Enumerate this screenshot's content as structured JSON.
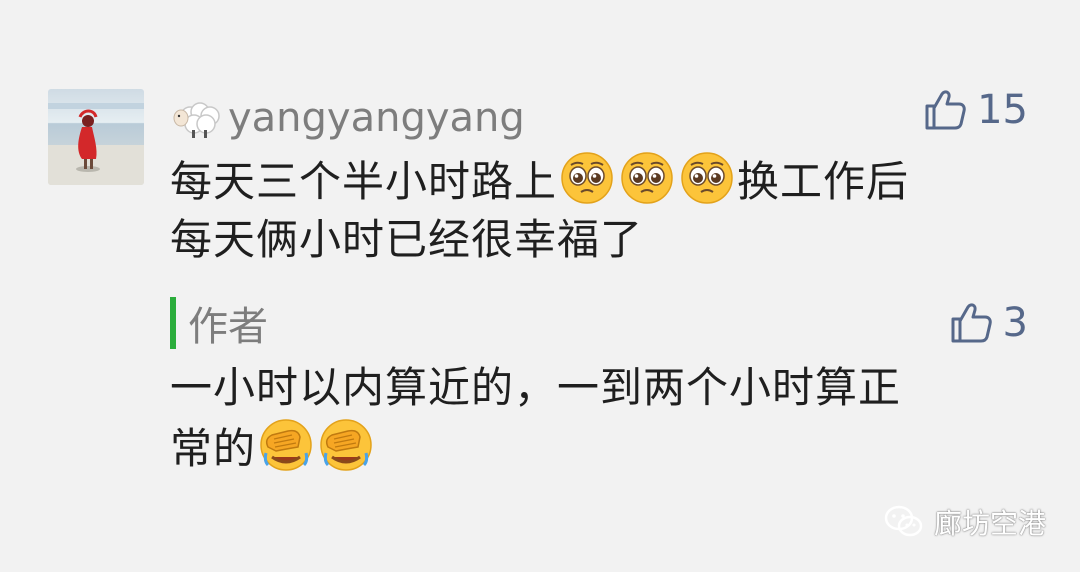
{
  "comment": {
    "username": "yangyangyang",
    "likes": "15",
    "text_line1": "每天三个半小时路上",
    "text_line1_after": "换工作后",
    "text_line2": "每天俩小时已经很幸福了",
    "icons": {
      "username_prefix": "sheep-icon",
      "emoji": "pleading-face-icon",
      "like": "thumbs-up-icon",
      "avatar": "avatar"
    }
  },
  "reply": {
    "author": "作者",
    "likes": "3",
    "text_line1": "一小时以内算近的，一到两个小时算正",
    "text_line2": "常的",
    "icons": {
      "emoji": "face-palm-icon"
    }
  },
  "watermark": {
    "text": "廊坊空港",
    "icon": "wechat-icon"
  },
  "colors": {
    "background": "#f2f2f2",
    "like_color": "#56688a",
    "reply_bar": "#2bad3c",
    "meta_text": "#7d7d7d",
    "body_text": "#1f1f1f"
  }
}
